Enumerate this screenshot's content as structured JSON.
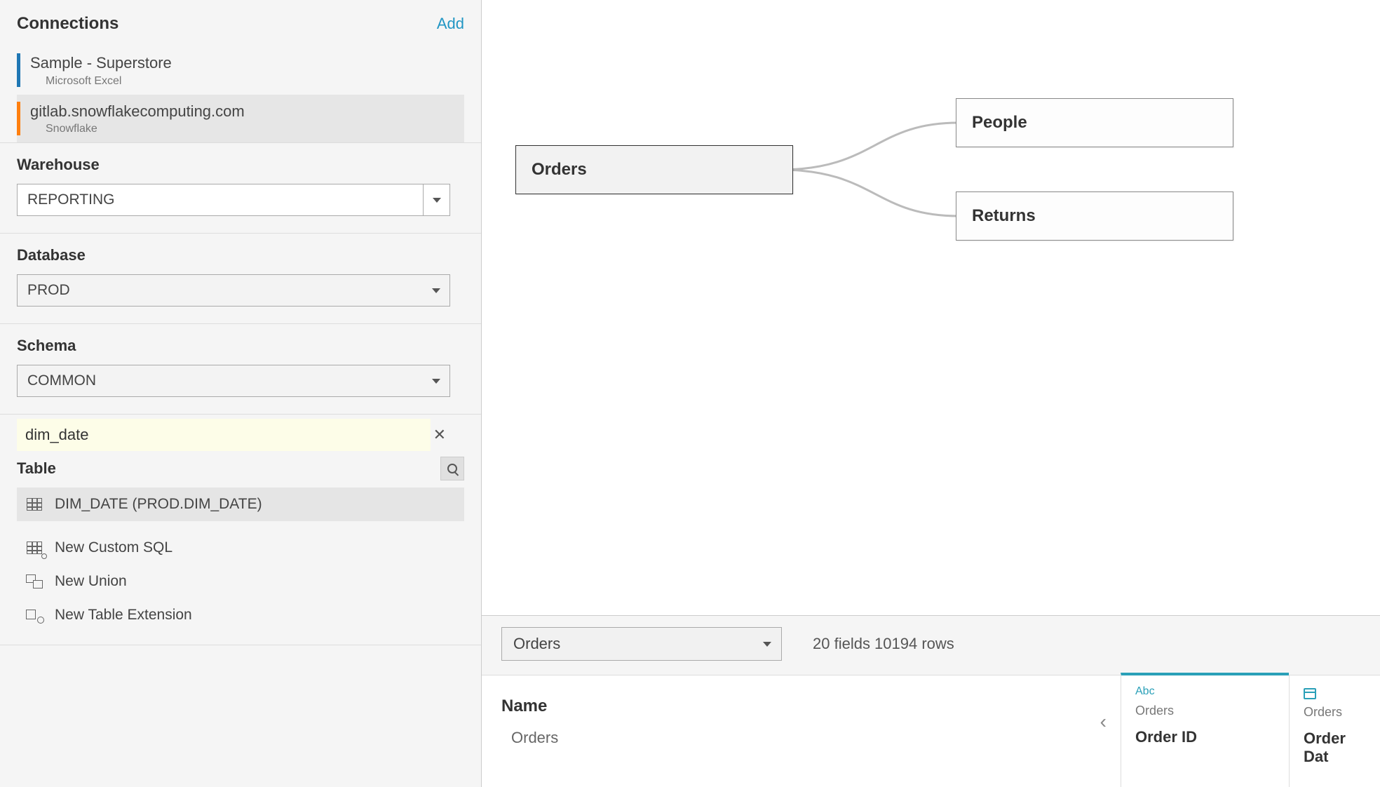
{
  "sidebar": {
    "connections_label": "Connections",
    "add_label": "Add",
    "connections": [
      {
        "name": "Sample - Superstore",
        "sub": "Microsoft Excel",
        "color": "blue",
        "selected": false
      },
      {
        "name": "gitlab.snowflakecomputing.com",
        "sub": "Snowflake",
        "color": "orange",
        "selected": true
      }
    ],
    "warehouse_label": "Warehouse",
    "warehouse_value": "REPORTING",
    "database_label": "Database",
    "database_value": "PROD",
    "schema_label": "Schema",
    "schema_value": "COMMON",
    "search_value": "dim_date",
    "table_label": "Table",
    "table_items": [
      {
        "name": "DIM_DATE (PROD.DIM_DATE)",
        "kind": "table",
        "selected": true
      },
      {
        "name": "New Custom SQL",
        "kind": "custom-sql",
        "selected": false
      },
      {
        "name": "New Union",
        "kind": "union",
        "selected": false
      },
      {
        "name": "New Table Extension",
        "kind": "extension",
        "selected": false
      }
    ]
  },
  "canvas": {
    "nodes": {
      "orders": "Orders",
      "people": "People",
      "returns": "Returns"
    }
  },
  "bottom": {
    "table_select": "Orders",
    "stats": "20 fields 10194 rows"
  },
  "grid": {
    "name_label": "Name",
    "name_value": "Orders",
    "columns": [
      {
        "type": "Abc",
        "type_kind": "abc",
        "source": "Orders",
        "name": "Order ID",
        "active": true
      },
      {
        "type": "date",
        "type_kind": "date",
        "source": "Orders",
        "name": "Order Dat",
        "active": false
      }
    ]
  }
}
